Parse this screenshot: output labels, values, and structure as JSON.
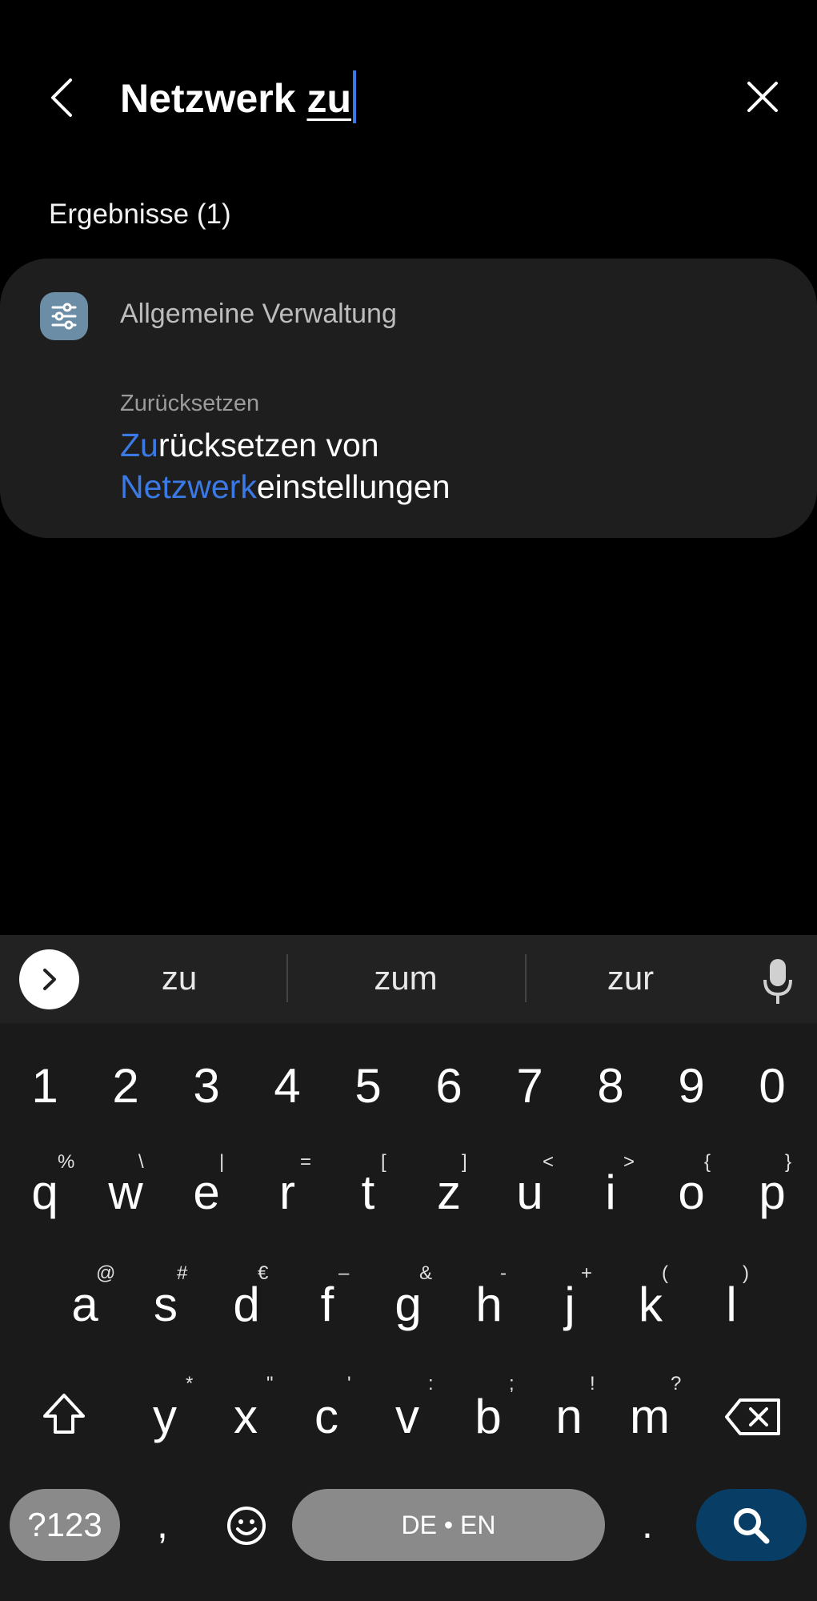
{
  "search": {
    "query_plain": "Netzwerk ",
    "query_typed": "zu"
  },
  "results": {
    "count_label": "Ergebnisse (1)",
    "items": [
      {
        "category": "Allgemeine Verwaltung",
        "subcategory": "Zurücksetzen",
        "title_parts": [
          "Zu",
          "rücksetzen von ",
          "Netzwerk",
          "einstellungen"
        ]
      }
    ]
  },
  "keyboard": {
    "suggestions": [
      "zu",
      "zum",
      "zur"
    ],
    "number_row": [
      "1",
      "2",
      "3",
      "4",
      "5",
      "6",
      "7",
      "8",
      "9",
      "0"
    ],
    "row1": [
      "q",
      "w",
      "e",
      "r",
      "t",
      "z",
      "u",
      "i",
      "o",
      "p"
    ],
    "row1_hints": [
      "%",
      "\\",
      "|",
      "=",
      "[",
      "]",
      "<",
      ">",
      "{",
      "}"
    ],
    "row2": [
      "a",
      "s",
      "d",
      "f",
      "g",
      "h",
      "j",
      "k",
      "l"
    ],
    "row2_hints": [
      "@",
      "#",
      "€",
      "–",
      "&",
      "-",
      "+",
      "(",
      ")"
    ],
    "row3": [
      "y",
      "x",
      "c",
      "v",
      "b",
      "n",
      "m"
    ],
    "row3_hints": [
      "*",
      "\"",
      "'",
      ":",
      ";",
      "!",
      "?"
    ],
    "sym_label": "?123",
    "comma": ",",
    "space_label": "DE • EN",
    "period": ".",
    "icons": {
      "back": "back-arrow-icon",
      "clear": "close-icon",
      "category": "sliders-icon",
      "expand": "chevron-right-icon",
      "mic": "microphone-icon",
      "shift": "shift-icon",
      "backspace": "backspace-icon",
      "emoji": "emoji-icon",
      "search": "search-icon"
    }
  },
  "colors": {
    "accent": "#3b7ae6",
    "card_bg": "#1e1e1e",
    "search_key": "#083e66"
  }
}
